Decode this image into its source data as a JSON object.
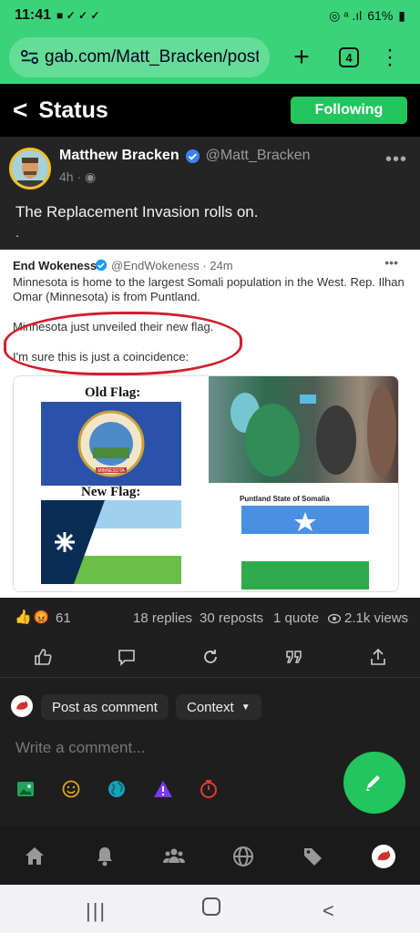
{
  "status_bar": {
    "time": "11:41",
    "battery": "61%"
  },
  "browser": {
    "url": "gab.com/Matt_Bracken/posts",
    "tab_count": "4"
  },
  "header": {
    "title": "Status",
    "follow_label": "Following"
  },
  "post": {
    "author_name": "Matthew Bracken",
    "author_handle": "@Matt_Bracken",
    "time": "4h ·",
    "text": "The Replacement Invasion rolls on.",
    "trailing": ".",
    "embedded": {
      "name": "End Wokeness",
      "meta": "@EndWokeness · 24m",
      "line1": "Minnesota is home to the largest Somali population in the West. Rep. Ilhan Omar (Minnesota) is from Puntland.",
      "line2": "Minnesota just unveiled their new flag.",
      "line3": "I'm sure this is just a coincidence:",
      "old_flag": "Old Flag:",
      "new_flag": "New Flag:",
      "seal_text": "MINNESOTA",
      "puntland": "Puntland State of Somalia"
    }
  },
  "stats": {
    "reactions": "61",
    "replies": "18 replies",
    "reposts": "30 reposts",
    "quotes": "1 quote",
    "views": "2.1k views"
  },
  "composer": {
    "post_as": "Post as comment",
    "context": "Context",
    "placeholder": "Write a comment..."
  },
  "colors": {
    "accent": "#22c55e",
    "browser": "#3bd37a",
    "flag_red": "#d21d2c"
  }
}
